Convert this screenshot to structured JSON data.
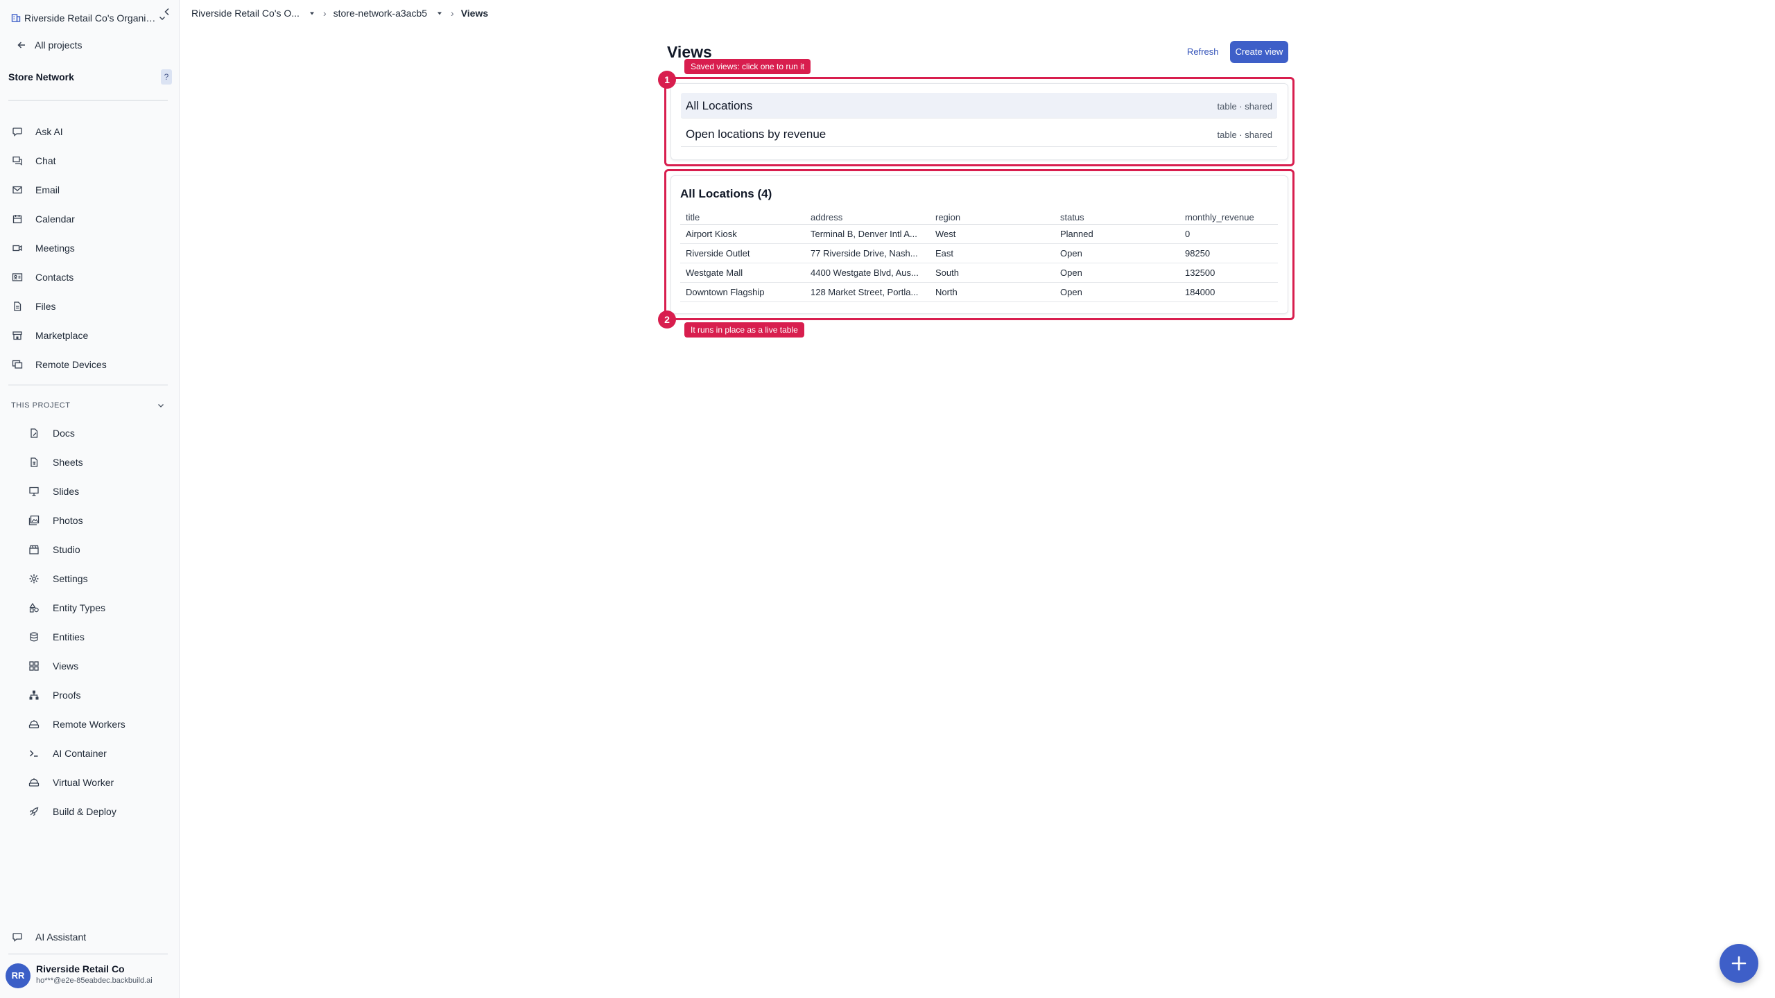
{
  "sidebar": {
    "org_name": "Riverside Retail Co's Organiz...",
    "back_label": "All projects",
    "project_name": "Store Network",
    "help_label": "?",
    "top_items": [
      {
        "label": "Ask AI",
        "icon": "chat-bubble-icon"
      },
      {
        "label": "Chat",
        "icon": "chat-icon"
      },
      {
        "label": "Email",
        "icon": "mail-icon"
      },
      {
        "label": "Calendar",
        "icon": "calendar-icon"
      },
      {
        "label": "Meetings",
        "icon": "video-icon"
      },
      {
        "label": "Contacts",
        "icon": "contacts-icon"
      },
      {
        "label": "Files",
        "icon": "file-icon"
      },
      {
        "label": "Marketplace",
        "icon": "store-icon"
      },
      {
        "label": "Remote Devices",
        "icon": "monitor-icon"
      }
    ],
    "section_label": "THIS PROJECT",
    "project_items": [
      {
        "label": "Docs",
        "icon": "doc-icon"
      },
      {
        "label": "Sheets",
        "icon": "sheet-icon"
      },
      {
        "label": "Slides",
        "icon": "presentation-icon"
      },
      {
        "label": "Photos",
        "icon": "photos-icon"
      },
      {
        "label": "Studio",
        "icon": "clapper-icon"
      },
      {
        "label": "Settings",
        "icon": "gear-icon"
      },
      {
        "label": "Entity Types",
        "icon": "shapes-icon"
      },
      {
        "label": "Entities",
        "icon": "database-icon"
      },
      {
        "label": "Views",
        "icon": "grid-icon"
      },
      {
        "label": "Proofs",
        "icon": "hierarchy-icon"
      },
      {
        "label": "Remote Workers",
        "icon": "worker-icon"
      },
      {
        "label": "AI Container",
        "icon": "terminal-icon"
      },
      {
        "label": "Virtual Worker",
        "icon": "worker-icon"
      },
      {
        "label": "Build & Deploy",
        "icon": "rocket-icon"
      }
    ],
    "assistant_label": "AI Assistant",
    "user": {
      "initials": "RR",
      "name": "Riverside Retail Co",
      "email": "ho***@e2e-85eabdec.backbuild.ai"
    }
  },
  "breadcrumb": {
    "org": "Riverside Retail Co's O...",
    "project": "store-network-a3acb5",
    "current": "Views",
    "separator": "›"
  },
  "main": {
    "title": "Views",
    "refresh_label": "Refresh",
    "create_label": "Create view",
    "callout1_num": "1",
    "callout1_text": "Saved views: click one to run it",
    "callout2_num": "2",
    "callout2_text": "It runs in place as a live table",
    "saved_views": [
      {
        "name": "All Locations",
        "meta": "table · shared"
      },
      {
        "name": "Open locations by revenue",
        "meta": "table · shared"
      }
    ],
    "result": {
      "title": "All Locations (4)",
      "columns": [
        "title",
        "address",
        "region",
        "status",
        "monthly_revenue"
      ],
      "rows": [
        [
          "Airport Kiosk",
          "Terminal B, Denver Intl A...",
          "West",
          "Planned",
          "0"
        ],
        [
          "Riverside Outlet",
          "77 Riverside Drive, Nash...",
          "East",
          "Open",
          "98250"
        ],
        [
          "Westgate Mall",
          "4400 Westgate Blvd, Aus...",
          "South",
          "Open",
          "132500"
        ],
        [
          "Downtown Flagship",
          "128 Market Street, Portla...",
          "North",
          "Open",
          "184000"
        ]
      ]
    }
  },
  "colors": {
    "accent": "#3e5fc8",
    "callout": "#d81e4e",
    "link": "#2f4fb7"
  }
}
